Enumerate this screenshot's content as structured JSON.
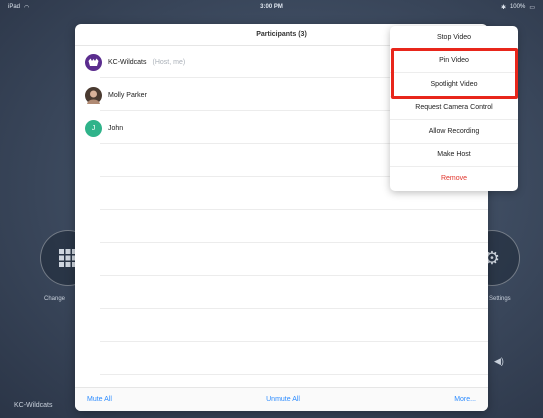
{
  "status": {
    "carrier": "iPad",
    "time": "3:00 PM",
    "battery": "100%"
  },
  "background": {
    "left_button_label": "Change",
    "right_button_label": "Settings",
    "meeting_name": "KC-Wildcats"
  },
  "panel": {
    "title": "Participants (3)",
    "participants": [
      {
        "name": "KC-Wildcats",
        "tag": "(Host, me)",
        "avatar_color": "#5b2d8e",
        "initial": ""
      },
      {
        "name": "Molly Parker",
        "tag": "",
        "avatar_color": "#4a3a30",
        "initial": ""
      },
      {
        "name": "John",
        "tag": "",
        "avatar_color": "#2fb38a",
        "initial": "J"
      }
    ],
    "footer": {
      "mute_all": "Mute All",
      "unmute_all": "Unmute All",
      "more": "More..."
    }
  },
  "menu": {
    "items": [
      "Stop Video",
      "Pin Video",
      "Spotlight Video",
      "Request Camera Control",
      "Allow Recording",
      "Make Host",
      "Remove"
    ]
  },
  "colors": {
    "accent": "#2d8cff",
    "danger": "#e0342b",
    "highlight": "#e8261b"
  }
}
